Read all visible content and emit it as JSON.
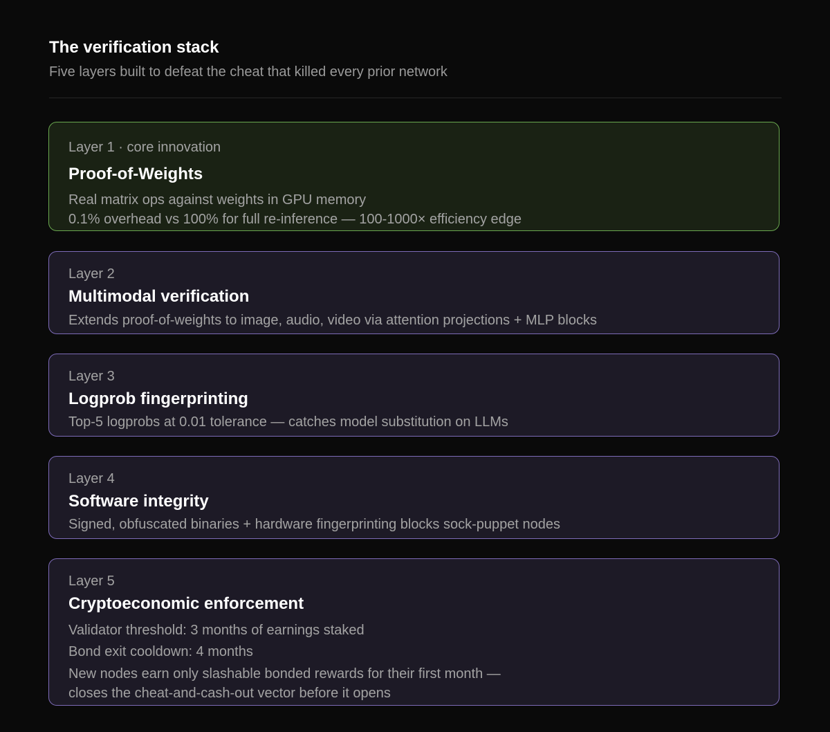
{
  "header": {
    "title": "The verification stack",
    "subtitle": "Five layers built to defeat the cheat that killed every prior network"
  },
  "layers": [
    {
      "label": "Layer 1 · core innovation",
      "title": "Proof-of-Weights",
      "lines": [
        "Real matrix ops against weights in GPU memory",
        "0.1% overhead vs 100% for full re-inference — 100-1000× efficiency edge"
      ]
    },
    {
      "label": "Layer 2",
      "title": "Multimodal verification",
      "lines": [
        "Extends proof-of-weights to image, audio, video via attention projections + MLP blocks"
      ]
    },
    {
      "label": "Layer 3",
      "title": "Logprob fingerprinting",
      "lines": [
        "Top-5 logprobs at 0.01 tolerance — catches model substitution on LLMs"
      ]
    },
    {
      "label": "Layer 4",
      "title": "Software integrity",
      "lines": [
        "Signed, obfuscated binaries + hardware fingerprinting blocks sock-puppet nodes"
      ]
    },
    {
      "label": "Layer 5",
      "title": "Cryptoeconomic enforcement",
      "lines": [
        "Validator threshold: 3 months of earnings staked",
        "Bond exit cooldown: 4 months",
        "New nodes earn only slashable bonded rewards for their first month —",
        "closes the cheat-and-cash-out vector before it opens"
      ]
    }
  ],
  "colors": {
    "background": "#0a0a0a",
    "core_border": "#6aa84f",
    "core_fill": "#1a2214",
    "layer_border": "#7d6bb8",
    "layer_fill": "#1d1a26"
  }
}
